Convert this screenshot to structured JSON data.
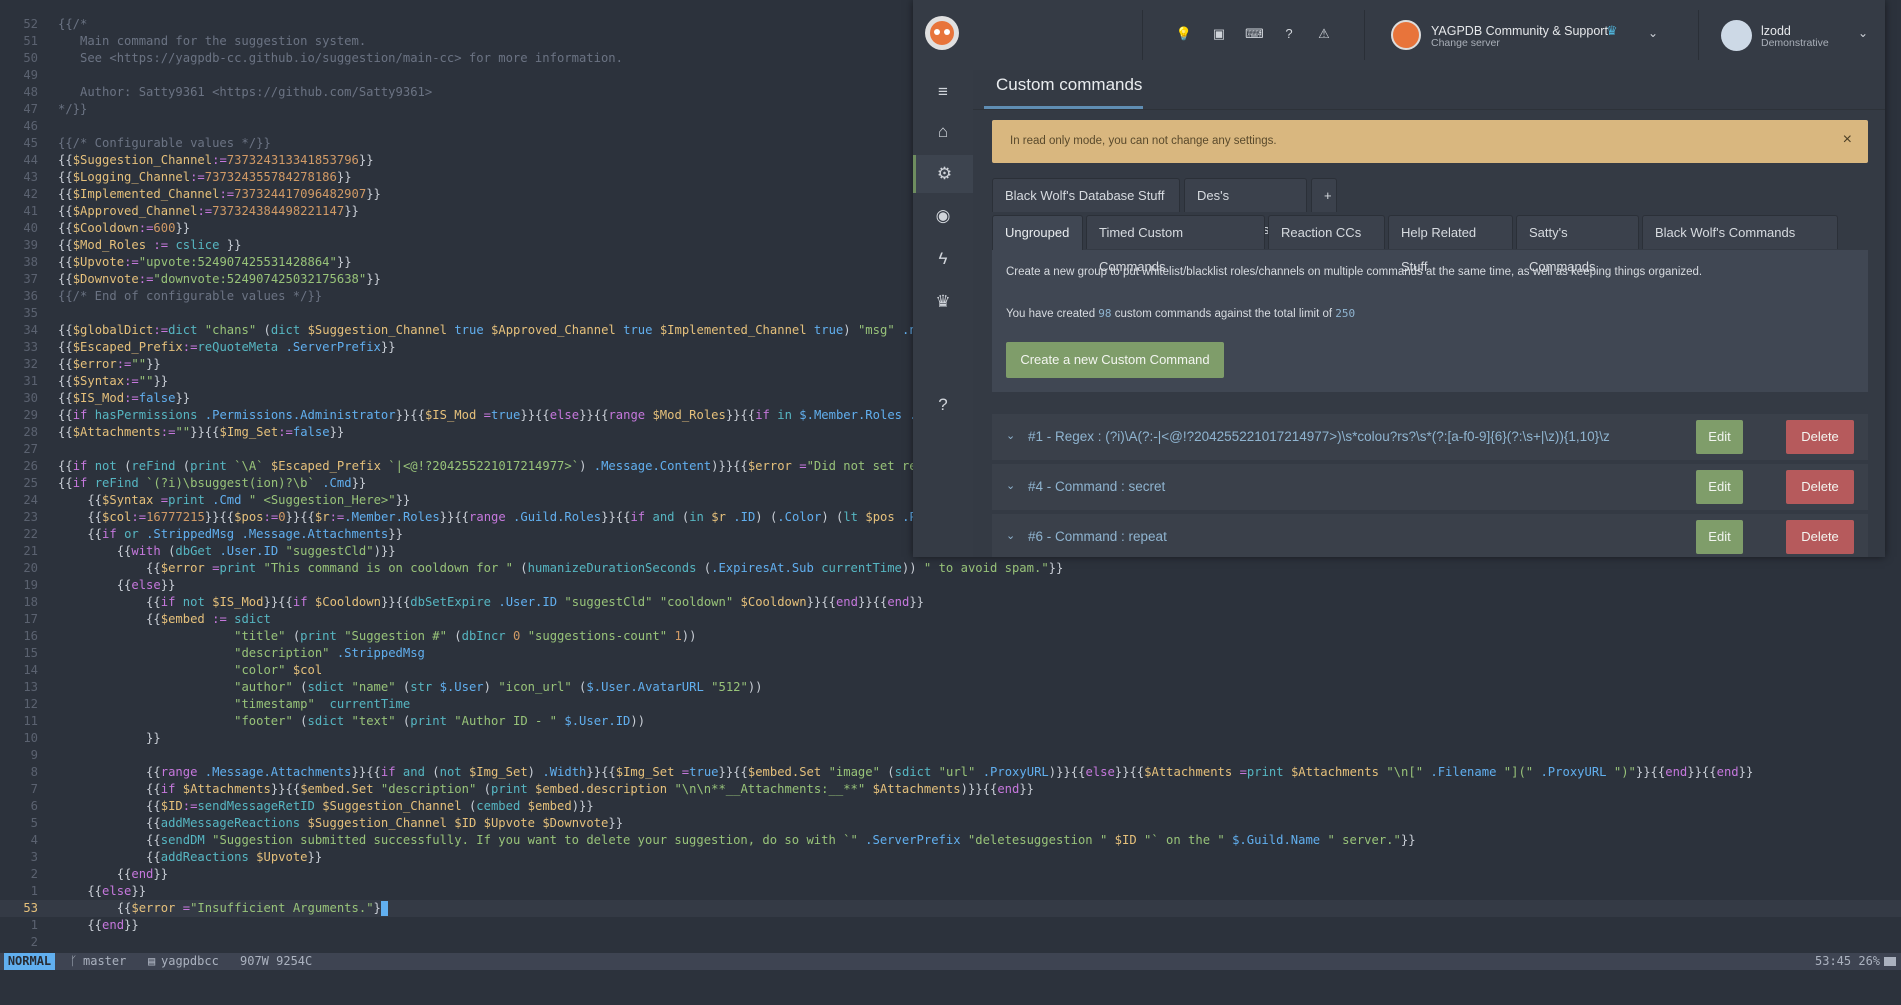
{
  "editor": {
    "lines": [
      {
        "n": "52",
        "html": "<span class='c-com'>{{/*</span>"
      },
      {
        "n": "51",
        "html": "<span class='c-com'>   Main command for the suggestion system.</span>"
      },
      {
        "n": "50",
        "html": "<span class='c-com'>   See &lt;https://yagpdb-cc.github.io/suggestion/main-cc&gt; for more information.</span>"
      },
      {
        "n": "49",
        "html": ""
      },
      {
        "n": "48",
        "html": "<span class='c-com'>   Author: Satty9361 &lt;https://github.com/Satty9361&gt;</span>"
      },
      {
        "n": "47",
        "html": "<span class='c-com'>*/}}</span>"
      },
      {
        "n": "46",
        "html": ""
      },
      {
        "n": "45",
        "html": "<span class='c-com'>{{/* Configurable values */}}</span>"
      },
      {
        "n": "44",
        "html": "{{<span class='c-var'>$Suggestion_Channel</span><span class='c-op'>:=</span><span class='c-num'>737324313341853796</span>}}"
      },
      {
        "n": "43",
        "html": "{{<span class='c-var'>$Logging_Channel</span><span class='c-op'>:=</span><span class='c-num'>737324355784278186</span>}}"
      },
      {
        "n": "42",
        "html": "{{<span class='c-var'>$Implemented_Channel</span><span class='c-op'>:=</span><span class='c-num'>737324417096482907</span>}}"
      },
      {
        "n": "41",
        "html": "{{<span class='c-var'>$Approved_Channel</span><span class='c-op'>:=</span><span class='c-num'>737324384498221147</span>}}"
      },
      {
        "n": "40",
        "html": "{{<span class='c-var'>$Cooldown</span><span class='c-op'>:=</span><span class='c-num'>600</span>}}"
      },
      {
        "n": "39",
        "html": "{{<span class='c-var'>$Mod_Roles</span> <span class='c-op'>:=</span> <span class='c-fn'>cslice</span> }}"
      },
      {
        "n": "38",
        "html": "{{<span class='c-var'>$Upvote</span><span class='c-op'>:=</span><span class='c-str'>\"upvote:524907425531428864\"</span>}}"
      },
      {
        "n": "37",
        "html": "{{<span class='c-var'>$Downvote</span><span class='c-op'>:=</span><span class='c-str'>\"downvote:524907425032175638\"</span>}}"
      },
      {
        "n": "36",
        "html": "<span class='c-com'>{{/* End of configurable values */}}</span>"
      },
      {
        "n": "35",
        "html": ""
      },
      {
        "n": "34",
        "html": "{{<span class='c-var'>$globalDict</span><span class='c-op'>:=</span><span class='c-fn'>dict</span> <span class='c-str'>\"chans\"</span> (<span class='c-fn'>dict</span> <span class='c-var'>$Suggestion_Channel</span> <span class='c-kw'>true</span> <span class='c-var'>$Approved_Channel</span> <span class='c-kw'>true</span> <span class='c-var'>$Implemented_Channel</span> <span class='c-kw'>true</span>) <span class='c-str'>\"msg\"</span> <span class='c-kw'>.nil</span>}}"
      },
      {
        "n": "33",
        "html": "{{<span class='c-var'>$Escaped_Prefix</span><span class='c-op'>:=</span><span class='c-fn'>reQuoteMeta</span> <span class='c-kw'>.ServerPrefix</span>}}"
      },
      {
        "n": "32",
        "html": "{{<span class='c-var'>$error</span><span class='c-op'>:=</span><span class='c-str'>\"\"</span>}}"
      },
      {
        "n": "31",
        "html": "{{<span class='c-var'>$Syntax</span><span class='c-op'>:=</span><span class='c-str'>\"\"</span>}}"
      },
      {
        "n": "30",
        "html": "{{<span class='c-var'>$IS_Mod</span><span class='c-op'>:=</span><span class='c-kw'>false</span>}}"
      },
      {
        "n": "29",
        "html": "{{<span class='c-op'>if</span> <span class='c-fn'>hasPermissions</span> <span class='c-kw'>.Permissions.Administrator</span>}}{{<span class='c-var'>$IS_Mod</span> <span class='c-op'>=</span><span class='c-kw'>true</span>}}{{<span class='c-op'>else</span>}}{{<span class='c-op'>range</span> <span class='c-var'>$Mod_Roles</span>}}{{<span class='c-op'>if</span> <span class='c-fn'>in</span> <span class='c-kw'>$.Member.Roles</span> <span class='c-kw'>.</span>}}{{<span class='c-var'>$IS_Mod</span> <span class='c-op'>=</span><span class='c-kw'>true</span>}}{{<span class='c-op'>end</span>}}{{<span class='c-op'>end</span>}}{{<span class='c-op'>end</span>}}"
      },
      {
        "n": "28",
        "html": "{{<span class='c-var'>$Attachments</span><span class='c-op'>:=</span><span class='c-str'>\"\"</span>}}{{<span class='c-var'>$Img_Set</span><span class='c-op'>:=</span><span class='c-kw'>false</span>}}"
      },
      {
        "n": "27",
        "html": ""
      },
      {
        "n": "26",
        "html": "{{<span class='c-op'>if</span> <span class='c-fn'>not</span> (<span class='c-fn'>reFind</span> (<span class='c-fn'>print</span> <span class='c-str'>`\\A`</span> <span class='c-var'>$Escaped_Prefix</span> <span class='c-str'>`|&lt;@!?204255221017214977&gt;`</span>) <span class='c-kw'>.Message.Content</span>)}}{{<span class='c-var'>$error</span> <span class='c-op'>=</span><span class='c-str'>\"Did not set regex to match Server Prefix\"</span>}}{{<span class='c-var'>$Syntax</span> <span class='c-op'>=</span> <span class='c-str'>`Prefix/Yag Mention &lt;Command&gt; &lt;Args&gt;`</span>}}{{<span class='c-op'>else</span>}}"
      },
      {
        "n": "25",
        "html": "{{<span class='c-op'>if</span> <span class='c-fn'>reFind</span> <span class='c-str'>`(?i)\\bsuggest(ion)?\\b`</span> <span class='c-kw'>.Cmd</span>}}"
      },
      {
        "n": "24",
        "html": "    {{<span class='c-var'>$Syntax</span> <span class='c-op'>=</span><span class='c-fn'>print</span> <span class='c-kw'>.Cmd</span> <span class='c-str'>\" &lt;Suggestion_Here&gt;\"</span>}}"
      },
      {
        "n": "23",
        "html": "    {{<span class='c-var'>$col</span><span class='c-op'>:=</span><span class='c-num'>16777215</span>}}{{<span class='c-var'>$pos</span><span class='c-op'>:=</span><span class='c-num'>0</span>}}{{<span class='c-var'>$r</span><span class='c-op'>:=</span><span class='c-kw'>.Member.Roles</span>}}{{<span class='c-op'>range</span> <span class='c-kw'>.Guild.Roles</span>}}{{<span class='c-op'>if</span> <span class='c-fn'>and</span> (<span class='c-fn'>in</span> <span class='c-var'>$r</span> <span class='c-kw'>.ID</span>) (<span class='c-kw'>.Color</span>) (<span class='c-fn'>lt</span> <span class='c-var'>$pos</span> <span class='c-kw'>.Position</span>)}}{{<span class='c-var'>$pos</span> <span class='c-op'>=</span><span class='c-kw'>.Position</span>}}{{<span class='c-var'>$col</span> <span class='c-op'>=</span><span class='c-kw'>.Color</span>}}{{<span class='c-op'>end</span>}}{{<span class='c-op'>end</span>}}"
      },
      {
        "n": "22",
        "html": "    {{<span class='c-op'>if</span> <span class='c-fn'>or</span> <span class='c-kw'>.StrippedMsg</span> <span class='c-kw'>.Message.Attachments</span>}}"
      },
      {
        "n": "21",
        "html": "        {{<span class='c-op'>with</span> (<span class='c-fn'>dbGet</span> <span class='c-kw'>.User.ID</span> <span class='c-str'>\"suggestCld\"</span>)}}"
      },
      {
        "n": "20",
        "html": "            {{<span class='c-var'>$error</span> <span class='c-op'>=</span><span class='c-fn'>print</span> <span class='c-str'>\"This command is on cooldown for \"</span> (<span class='c-fn'>humanizeDurationSeconds</span> (<span class='c-kw'>.ExpiresAt.Sub</span> <span class='c-fn'>currentTime</span>)) <span class='c-str'>\" to avoid spam.\"</span>}}"
      },
      {
        "n": "19",
        "html": "        {{<span class='c-op'>else</span>}}"
      },
      {
        "n": "18",
        "html": "            {{<span class='c-op'>if</span> <span class='c-fn'>not</span> <span class='c-var'>$IS_Mod</span>}}{{<span class='c-op'>if</span> <span class='c-var'>$Cooldown</span>}}{{<span class='c-fn'>dbSetExpire</span> <span class='c-kw'>.User.ID</span> <span class='c-str'>\"suggestCld\"</span> <span class='c-str'>\"cooldown\"</span> <span class='c-var'>$Cooldown</span>}}{{<span class='c-op'>end</span>}}{{<span class='c-op'>end</span>}}"
      },
      {
        "n": "17",
        "html": "            {{<span class='c-var'>$embed</span> <span class='c-op'>:=</span> <span class='c-fn'>sdict</span>"
      },
      {
        "n": "16",
        "html": "                        <span class='c-str'>\"title\"</span> (<span class='c-fn'>print</span> <span class='c-str'>\"Suggestion #\"</span> (<span class='c-fn'>dbIncr</span> <span class='c-num'>0</span> <span class='c-str'>\"suggestions-count\"</span> <span class='c-num'>1</span>))"
      },
      {
        "n": "15",
        "html": "                        <span class='c-str'>\"description\"</span> <span class='c-kw'>.StrippedMsg</span>"
      },
      {
        "n": "14",
        "html": "                        <span class='c-str'>\"color\"</span> <span class='c-var'>$col</span>"
      },
      {
        "n": "13",
        "html": "                        <span class='c-str'>\"author\"</span> (<span class='c-fn'>sdict</span> <span class='c-str'>\"name\"</span> (<span class='c-fn'>str</span> <span class='c-kw'>$.User</span>) <span class='c-str'>\"icon_url\"</span> (<span class='c-kw'>$.User.AvatarURL</span> <span class='c-str'>\"512\"</span>))"
      },
      {
        "n": "12",
        "html": "                        <span class='c-str'>\"timestamp\"</span>  <span class='c-fn'>currentTime</span>"
      },
      {
        "n": "11",
        "html": "                        <span class='c-str'>\"footer\"</span> (<span class='c-fn'>sdict</span> <span class='c-str'>\"text\"</span> (<span class='c-fn'>print</span> <span class='c-str'>\"Author ID - \"</span> <span class='c-kw'>$.User.ID</span>))"
      },
      {
        "n": "10",
        "html": "            }}"
      },
      {
        "n": "9",
        "html": ""
      },
      {
        "n": "8",
        "html": "            {{<span class='c-op'>range</span> <span class='c-kw'>.Message.Attachments</span>}}{{<span class='c-op'>if</span> <span class='c-fn'>and</span> (<span class='c-fn'>not</span> <span class='c-var'>$Img_Set</span>) <span class='c-kw'>.Width</span>}}{{<span class='c-var'>$Img_Set</span> <span class='c-op'>=</span><span class='c-kw'>true</span>}}{{<span class='c-var'>$embed.Set</span> <span class='c-str'>\"image\"</span> (<span class='c-fn'>sdict</span> <span class='c-str'>\"url\"</span> <span class='c-kw'>.ProxyURL</span>)}}{{<span class='c-op'>else</span>}}{{<span class='c-var'>$Attachments</span> <span class='c-op'>=</span><span class='c-fn'>print</span> <span class='c-var'>$Attachments</span> <span class='c-str'>\"\\n[\"</span> <span class='c-kw'>.Filename</span> <span class='c-str'>\"](\"</span> <span class='c-kw'>.ProxyURL</span> <span class='c-str'>\")\"</span>}}{{<span class='c-op'>end</span>}}{{<span class='c-op'>end</span>}}"
      },
      {
        "n": "7",
        "html": "            {{<span class='c-op'>if</span> <span class='c-var'>$Attachments</span>}}{{<span class='c-var'>$embed.Set</span> <span class='c-str'>\"description\"</span> (<span class='c-fn'>print</span> <span class='c-var'>$embed.description</span> <span class='c-str'>\"\\n\\n**__Attachments:__**\"</span> <span class='c-var'>$Attachments</span>)}}{{<span class='c-op'>end</span>}}"
      },
      {
        "n": "6",
        "html": "            {{<span class='c-var'>$ID</span><span class='c-op'>:=</span><span class='c-fn'>sendMessageRetID</span> <span class='c-var'>$Suggestion_Channel</span> (<span class='c-fn'>cembed</span> <span class='c-var'>$embed</span>)}}"
      },
      {
        "n": "5",
        "html": "            {{<span class='c-fn'>addMessageReactions</span> <span class='c-var'>$Suggestion_Channel</span> <span class='c-var'>$ID</span> <span class='c-var'>$Upvote</span> <span class='c-var'>$Downvote</span>}}"
      },
      {
        "n": "4",
        "html": "            {{<span class='c-fn'>sendDM</span> <span class='c-str'>\"Suggestion submitted successfully. If you want to delete your suggestion, do so with `\"</span> <span class='c-kw'>.ServerPrefix</span> <span class='c-str'>\"deletesuggestion \"</span> <span class='c-var'>$ID</span> <span class='c-str'>\"` on the \"</span> <span class='c-kw'>$.Guild.Name</span> <span class='c-str'>\" server.\"</span>}}"
      },
      {
        "n": "3",
        "html": "            {{<span class='c-fn'>addReactions</span> <span class='c-var'>$Upvote</span>}}"
      },
      {
        "n": "2",
        "html": "        {{<span class='c-op'>end</span>}}"
      },
      {
        "n": "1",
        "html": "    {{<span class='c-op'>else</span>}}"
      },
      {
        "n": "53",
        "html": "        {{<span class='c-var'>$error</span> <span class='c-op'>=</span><span class='c-str'>\"Insufficient Arguments.\"</span>}<span id='cursor'></span>",
        "current": true
      },
      {
        "n": "1",
        "html": "    {{<span class='c-op'>end</span>}}"
      },
      {
        "n": "2",
        "html": ""
      }
    ]
  },
  "statusbar": {
    "mode": "NORMAL",
    "branch_icon": "branch-icon",
    "branch": "master",
    "file_icon": "file-icon",
    "filename": "yagpdbcc",
    "counts": "907W 9254C",
    "position": "53:45 26%"
  },
  "browser": {
    "topbar": {
      "icons": [
        "lightbulb-icon",
        "inbox-icon",
        "keyboard-icon",
        "question-icon",
        "warning-icon"
      ],
      "icon_glyphs": [
        "💡",
        "▣",
        "⌨",
        "?",
        "⚠"
      ],
      "server_name": "YAGPDB Community & Support",
      "server_sub": "Change server",
      "user_name": "lzodd",
      "user_sub": "Demonstrative"
    },
    "sidebar": [
      {
        "name": "menu-icon",
        "glyph": "≡"
      },
      {
        "name": "home-icon",
        "glyph": "⌂"
      },
      {
        "name": "gears-icon",
        "glyph": "⚙"
      },
      {
        "name": "rss-icon",
        "glyph": "◉"
      },
      {
        "name": "bolt-icon",
        "glyph": "ϟ"
      },
      {
        "name": "trophy-icon",
        "glyph": "♛"
      },
      {
        "name": "help-icon",
        "glyph": "?"
      }
    ],
    "page_title": "Custom commands",
    "alert": {
      "text": "In read only mode, you can not change any settings.",
      "close": "×"
    },
    "tabs_row1": [
      "Black Wolf's Database Stuff",
      "Des's Experiments",
      "+"
    ],
    "tabs_row2": [
      "Ungrouped",
      "Timed Custom Commands",
      "Reaction CCs",
      "Help Related Stuff",
      "Satty's Commands",
      "Black Wolf's Commands"
    ],
    "panel": {
      "text1": "Create a new group to put whitelist/blacklist roles/channels on multiple commands at the same time, as well as keeping things organized.",
      "text2_a": "You have created",
      "created": "98",
      "text2_b": "custom commands against the total limit of",
      "limit": "250",
      "create_btn": "Create a new Custom Command"
    },
    "commands": [
      {
        "title": "#1 - Regex : (?i)\\A(?:-|<@!?204255221017214977>)\\s*colou?rs?\\s*(?:[a-f0-9]{6}(?:\\s+|\\z)){1,10}\\z",
        "edit": "Edit",
        "delete": "Delete"
      },
      {
        "title": "#4 - Command : secret",
        "edit": "Edit",
        "delete": "Delete"
      },
      {
        "title": "#6 - Command : repeat",
        "edit": "Edit",
        "delete": "Delete"
      }
    ]
  }
}
